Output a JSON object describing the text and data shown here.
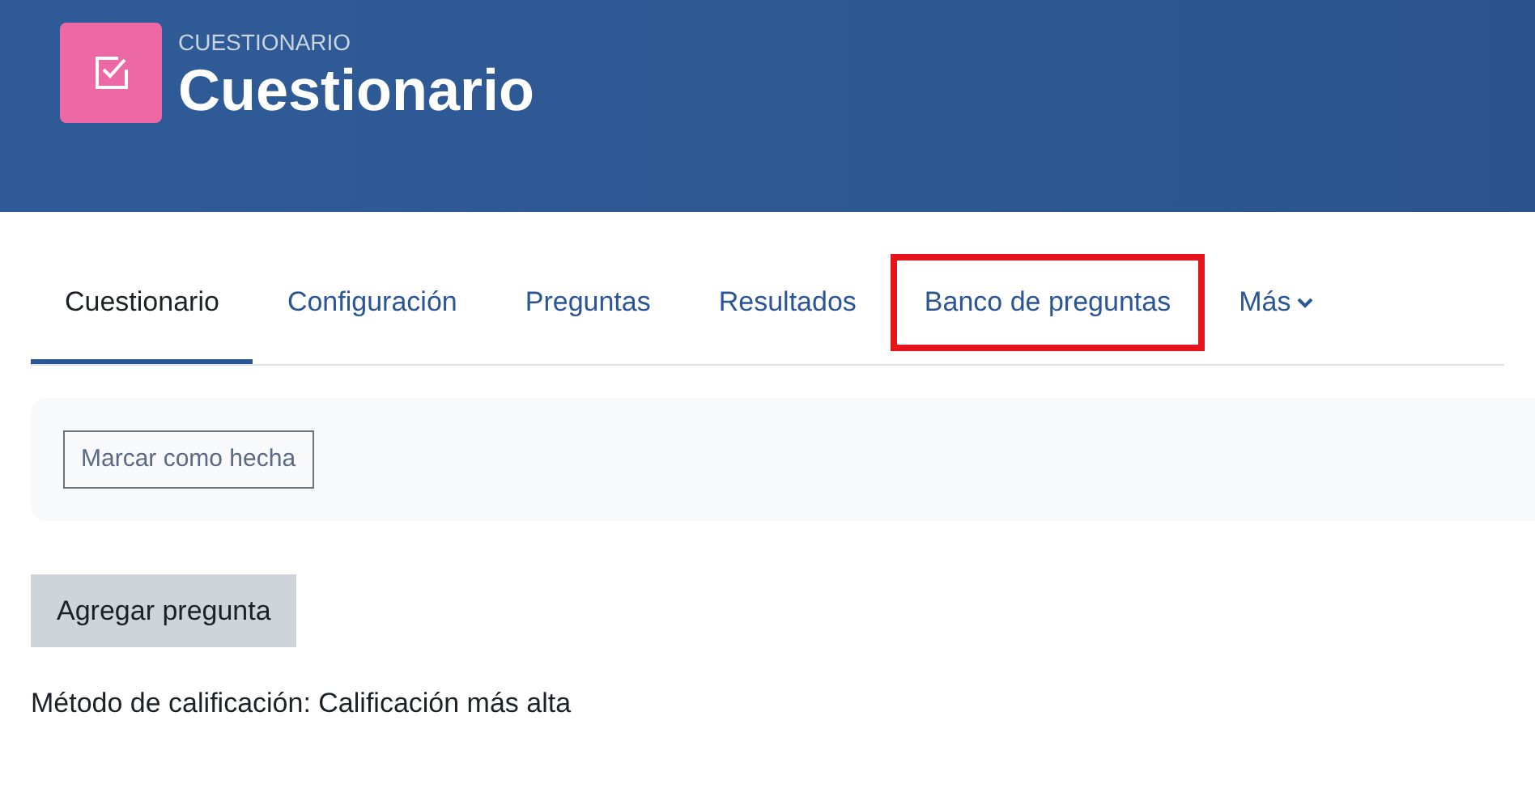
{
  "header": {
    "overline": "CUESTIONARIO",
    "title": "Cuestionario"
  },
  "tabs": [
    {
      "label": "Cuestionario",
      "selected": true,
      "highlighted": false
    },
    {
      "label": "Configuración",
      "selected": false,
      "highlighted": false
    },
    {
      "label": "Preguntas",
      "selected": false,
      "highlighted": false
    },
    {
      "label": "Resultados",
      "selected": false,
      "highlighted": false
    },
    {
      "label": "Banco de preguntas",
      "selected": false,
      "highlighted": true
    },
    {
      "label": "Más",
      "selected": false,
      "highlighted": false,
      "kind": "dropdown"
    }
  ],
  "completion_button": "Marcar como hecha",
  "add_question_button": "Agregar pregunta",
  "grading_method": "Método de calificación: Calificación más alta"
}
